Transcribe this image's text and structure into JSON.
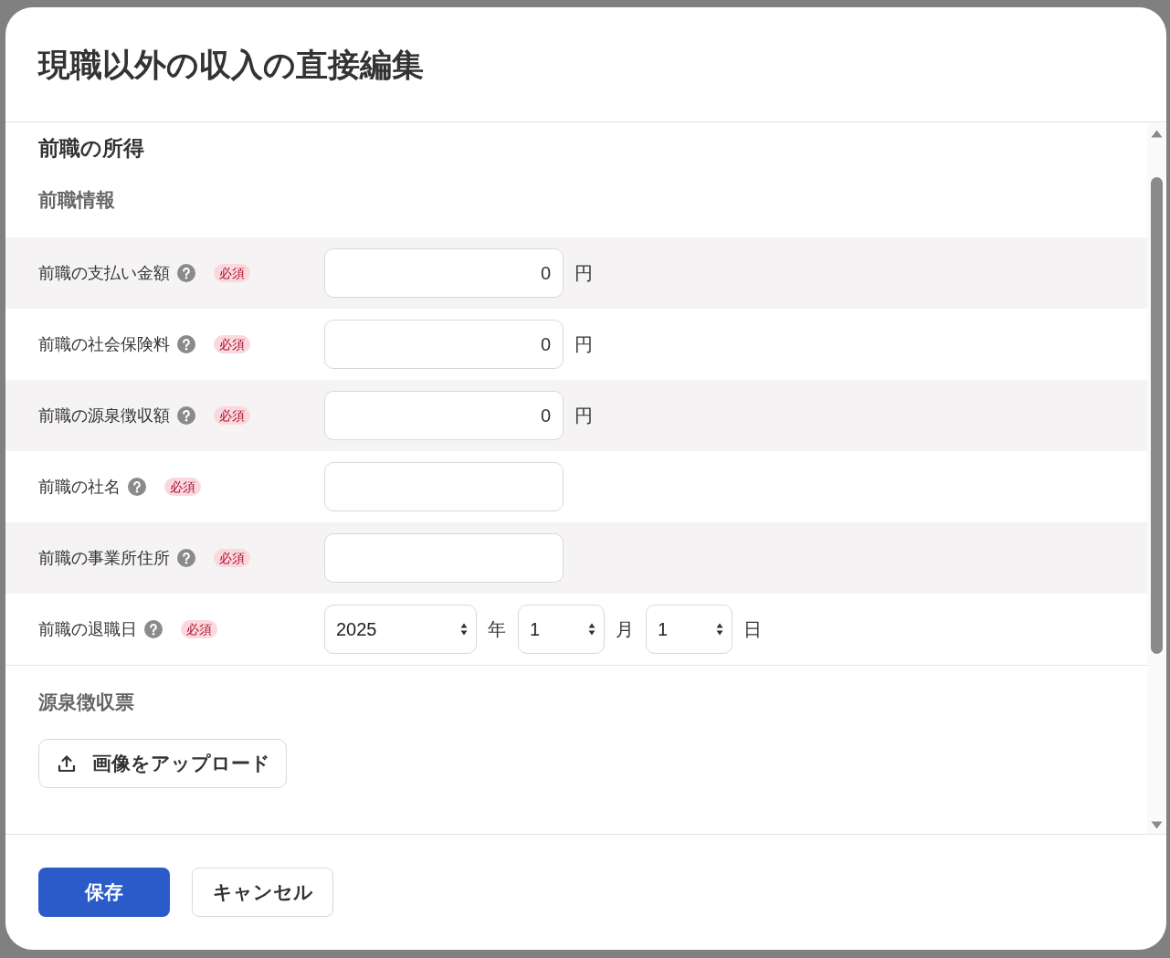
{
  "dialog": {
    "title": "現職以外の収入の直接編集"
  },
  "section": {
    "title": "前職の所得",
    "previous_job_info": {
      "title": "前職情報",
      "fields": [
        {
          "kind": "amount",
          "label": "前職の支払い金額",
          "badge": "必須",
          "value": "0",
          "unit": "円"
        },
        {
          "kind": "amount",
          "label": "前職の社会保険料",
          "badge": "必須",
          "value": "0",
          "unit": "円"
        },
        {
          "kind": "amount",
          "label": "前職の源泉徴収額",
          "badge": "必須",
          "value": "0",
          "unit": "円"
        },
        {
          "kind": "text",
          "label": "前職の社名",
          "badge": "必須"
        },
        {
          "kind": "text",
          "label": "前職の事業所住所",
          "badge": "必須"
        },
        {
          "kind": "date",
          "label": "前職の退職日",
          "badge": "必須",
          "parts": [
            {
              "value": "2025",
              "unit": "年"
            },
            {
              "value": "1",
              "unit": "月"
            },
            {
              "value": "1",
              "unit": "日"
            }
          ]
        }
      ]
    },
    "withholding_slip": {
      "title": "源泉徴収票",
      "upload_button": {
        "label": "画像をアップロード"
      }
    }
  },
  "footer": {
    "buttons": [
      {
        "kind": "primary",
        "label": "保存"
      },
      {
        "kind": "secondary",
        "label": "キャンセル"
      }
    ]
  }
}
